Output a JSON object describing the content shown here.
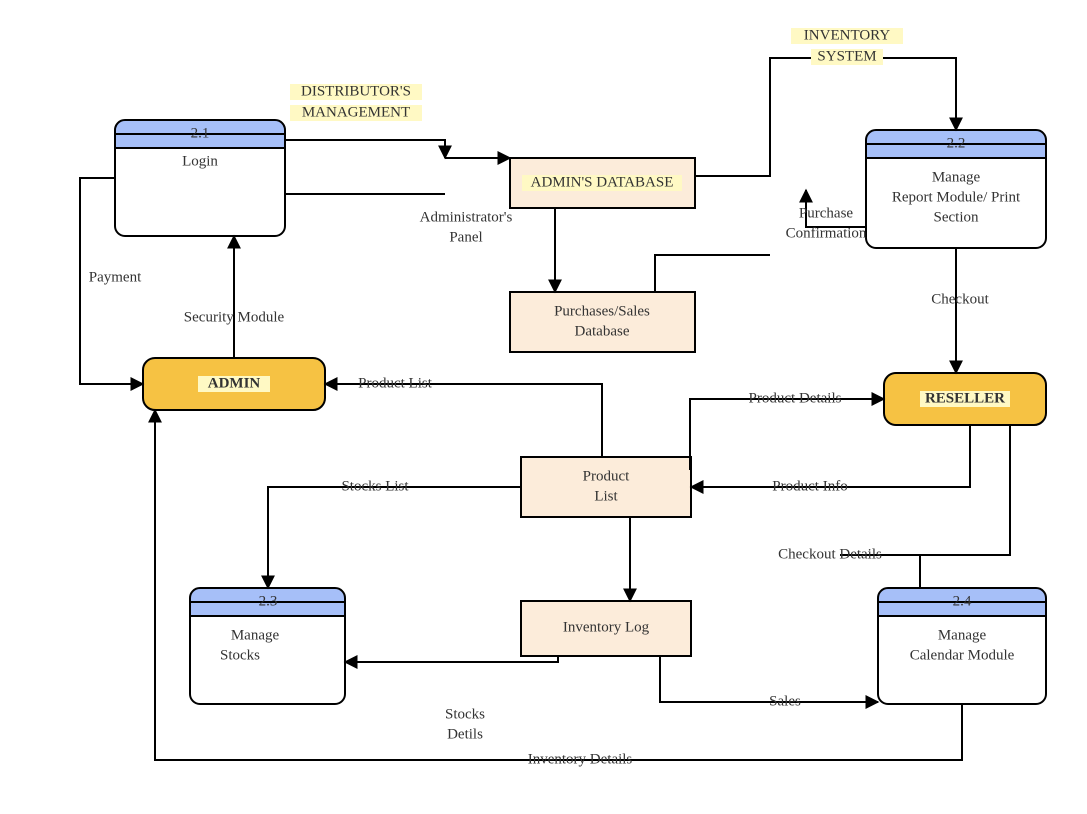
{
  "title": {
    "line1": "INVENTORY",
    "line2": "SYSTEM"
  },
  "distributor": {
    "line1": "DISTRIBUTOR'S",
    "line2": "MANAGEMENT"
  },
  "processes": {
    "p21": {
      "id": "2.1",
      "label": "Login"
    },
    "p22": {
      "id": "2.2",
      "l1": "Manage",
      "l2": "Report Module/ Print",
      "l3": "Section"
    },
    "p23": {
      "id": "2.3",
      "l1": "Manage",
      "l2": "Stocks"
    },
    "p24": {
      "id": "2.4",
      "l1": "Manage",
      "l2": "Calendar Module"
    }
  },
  "stores": {
    "adminDb": "ADMIN'S DATABASE",
    "psDb": {
      "l1": "Purchases/Sales",
      "l2": "Database"
    },
    "plist": {
      "l1": "Product",
      "l2": "List"
    },
    "ilog": "Inventory Log"
  },
  "agents": {
    "admin": "ADMIN",
    "reseller": "RESELLER"
  },
  "edges": {
    "payment": "Payment",
    "secMod": "Security Module",
    "adminPanel": {
      "l1": "Administrator's",
      "l2": "Panel"
    },
    "purchConf": {
      "l1": "Purchase",
      "l2": "Confirmation"
    },
    "checkout": "Checkout",
    "prodList": "Product List",
    "prodDet": "Product Details",
    "prodInfo": "Product Info",
    "stocksList": "Stocks List",
    "chkDet": "Checkout Details",
    "sales": "Sales",
    "stocksDet": {
      "l1": "Stocks",
      "l2": "Detils"
    },
    "invDet": "Inventory Details"
  }
}
